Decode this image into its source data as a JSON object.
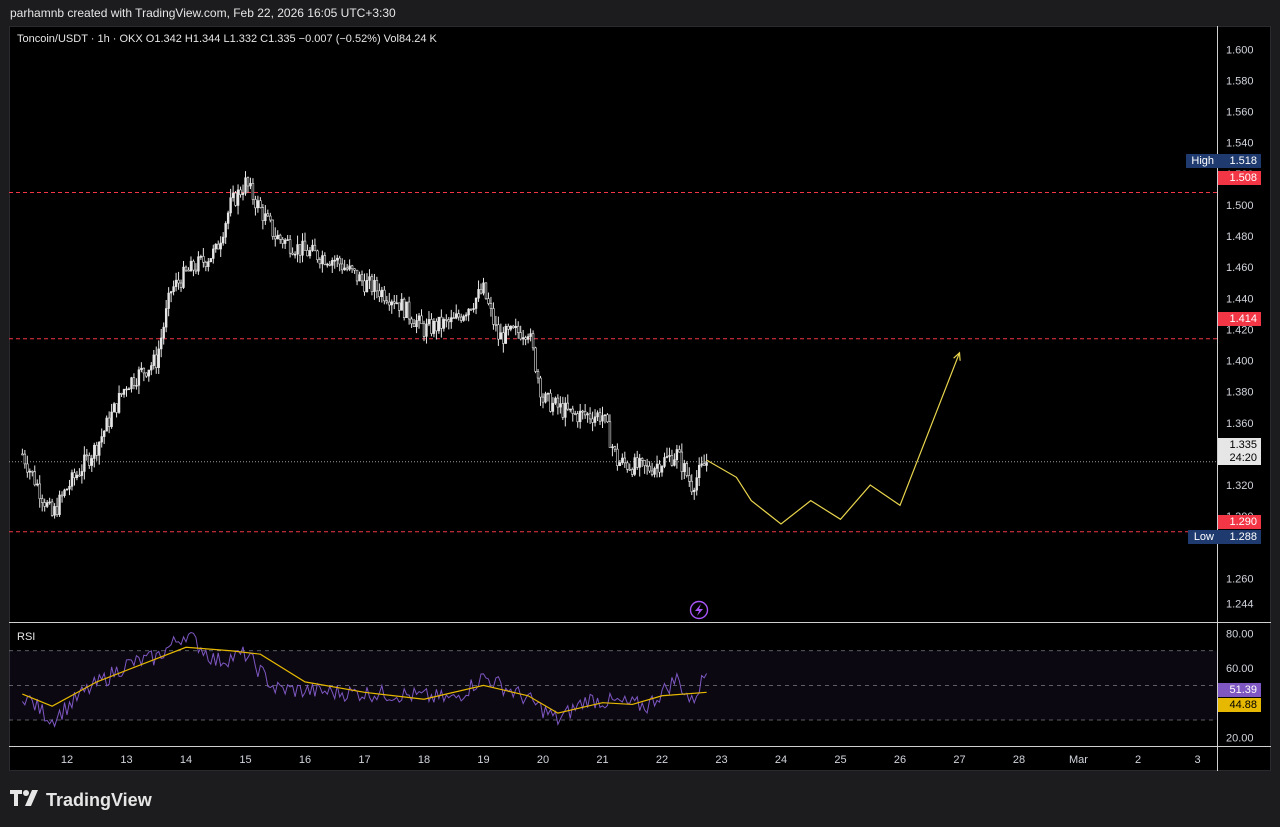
{
  "header": {
    "attribution": "parhamnb created with TradingView.com, Feb 22, 2026 16:05 UTC+3:30"
  },
  "legend": {
    "text": "Toncoin/USDT · 1h · OKX   O1.342  H1.344  L1.332  C1.335  −0.007 (−0.52%)  Vol84.24 K"
  },
  "price_tags": {
    "high_label": "High",
    "high_value": "1.518",
    "r1": "1.508",
    "r2": "1.414",
    "last": "1.335",
    "countdown": "24:20",
    "s1": "1.290",
    "low_label": "Low",
    "low_value": "1.288"
  },
  "rsi": {
    "label": "RSI",
    "value": "51.39",
    "ma_value": "44.88"
  },
  "footer": {
    "brand": "TradingView"
  },
  "colors": {
    "candle": "#e6e6e6",
    "level": "#f23645",
    "projection": "#e8d44d",
    "rsi_line": "#7e57c2",
    "rsi_ma": "#e6b800",
    "tag_blue": "#1e3a6e"
  },
  "chart_data": {
    "type": "candlestick",
    "symbol": "Toncoin/USDT",
    "interval": "1h",
    "exchange": "OKX",
    "ylim": [
      1.232,
      1.615
    ],
    "y_ticks": [
      "1.600",
      "1.580",
      "1.560",
      "1.540",
      "1.520",
      "1.500",
      "1.480",
      "1.460",
      "1.440",
      "1.420",
      "1.400",
      "1.380",
      "1.360",
      "1.340",
      "1.320",
      "1.300",
      "1.260",
      "1.244"
    ],
    "x_ticks": [
      "12",
      "13",
      "14",
      "15",
      "16",
      "17",
      "18",
      "19",
      "20",
      "21",
      "22",
      "23",
      "24",
      "25",
      "26",
      "27",
      "28",
      "Mar",
      "2",
      "3"
    ],
    "price_path": [
      [
        "Feb 11 06:00",
        1.34
      ],
      [
        "Feb 11 18:00",
        1.3
      ],
      [
        "Feb 12 00:00",
        1.318
      ],
      [
        "Feb 12 12:00",
        1.345
      ],
      [
        "Feb 13 00:00",
        1.385
      ],
      [
        "Feb 13 12:00",
        1.4
      ],
      [
        "Feb 13 18:00",
        1.445
      ],
      [
        "Feb 14 00:00",
        1.456
      ],
      [
        "Feb 14 12:00",
        1.47
      ],
      [
        "Feb 14 18:00",
        1.5
      ],
      [
        "Feb 15 00:00",
        1.514
      ],
      [
        "Feb 15 12:00",
        1.48
      ],
      [
        "Feb 16 00:00",
        1.47
      ],
      [
        "Feb 16 12:00",
        1.465
      ],
      [
        "Feb 17 00:00",
        1.45
      ],
      [
        "Feb 17 12:00",
        1.44
      ],
      [
        "Feb 18 00:00",
        1.42
      ],
      [
        "Feb 18 12:00",
        1.425
      ],
      [
        "Feb 19 00:00",
        1.445
      ],
      [
        "Feb 19 06:00",
        1.415
      ],
      [
        "Feb 19 18:00",
        1.42
      ],
      [
        "Feb 20 00:00",
        1.375
      ],
      [
        "Feb 20 12:00",
        1.365
      ],
      [
        "Feb 21 00:00",
        1.365
      ],
      [
        "Feb 21 06:00",
        1.335
      ],
      [
        "Feb 21 18:00",
        1.33
      ],
      [
        "Feb 22 06:00",
        1.34
      ],
      [
        "Feb 22 12:00",
        1.32
      ],
      [
        "Feb 22 18:00",
        1.335
      ]
    ],
    "levels": [
      1.508,
      1.414,
      1.29
    ],
    "last_price": 1.335,
    "high": 1.518,
    "low": 1.288,
    "projection": [
      [
        "Feb 22 18:00",
        1.336
      ],
      [
        "Feb 23 06:00",
        1.325
      ],
      [
        "Feb 23 12:00",
        1.31
      ],
      [
        "Feb 24 00:00",
        1.295
      ],
      [
        "Feb 24 12:00",
        1.31
      ],
      [
        "Feb 25 00:00",
        1.298
      ],
      [
        "Feb 25 12:00",
        1.32
      ],
      [
        "Feb 26 00:00",
        1.307
      ],
      [
        "Feb 27 00:00",
        1.405
      ]
    ],
    "rsi": {
      "ylim": [
        15,
        86
      ],
      "y_ticks": [
        "80.00",
        "60.00",
        "20.00"
      ],
      "bands": [
        70,
        50,
        30
      ],
      "value": 51.39,
      "ma": 44.88,
      "path": [
        [
          "Feb 11 06:00",
          45
        ],
        [
          "Feb 11 18:00",
          30
        ],
        [
          "Feb 12 06:00",
          45
        ],
        [
          "Feb 13 00:00",
          62
        ],
        [
          "Feb 13 12:00",
          66
        ],
        [
          "Feb 14 00:00",
          80
        ],
        [
          "Feb 14 12:00",
          64
        ],
        [
          "Feb 15 00:00",
          68
        ],
        [
          "Feb 15 12:00",
          48
        ],
        [
          "Feb 16 12:00",
          46
        ],
        [
          "Feb 17 12:00",
          45
        ],
        [
          "Feb 18 12:00",
          42
        ],
        [
          "Feb 19 00:00",
          55
        ],
        [
          "Feb 19 18:00",
          42
        ],
        [
          "Feb 20 06:00",
          30
        ],
        [
          "Feb 20 18:00",
          42
        ],
        [
          "Feb 21 06:00",
          40
        ],
        [
          "Feb 21 18:00",
          38
        ],
        [
          "Feb 22 06:00",
          54
        ],
        [
          "Feb 22 12:00",
          40
        ],
        [
          "Feb 22 18:00",
          58
        ]
      ],
      "ma_path": [
        [
          "Feb 11 06:00",
          45
        ],
        [
          "Feb 11 18:00",
          38
        ],
        [
          "Feb 12 12:00",
          52
        ],
        [
          "Feb 13 06:00",
          62
        ],
        [
          "Feb 14 00:00",
          72
        ],
        [
          "Feb 14 18:00",
          70
        ],
        [
          "Feb 15 06:00",
          68
        ],
        [
          "Feb 16 00:00",
          52
        ],
        [
          "Feb 17 00:00",
          46
        ],
        [
          "Feb 18 00:00",
          42
        ],
        [
          "Feb 19 00:00",
          50
        ],
        [
          "Feb 19 18:00",
          44
        ],
        [
          "Feb 20 06:00",
          34
        ],
        [
          "Feb 21 00:00",
          40
        ],
        [
          "Feb 21 12:00",
          39
        ],
        [
          "Feb 22 00:00",
          44
        ],
        [
          "Feb 22 18:00",
          46
        ]
      ]
    }
  }
}
